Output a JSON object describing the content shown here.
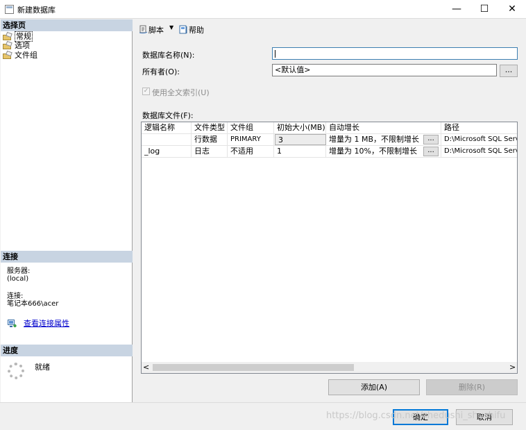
{
  "window": {
    "title": "新建数据库",
    "minimize_glyph": "—",
    "maximize_glyph": "☐",
    "close_glyph": "✕"
  },
  "left_panel": {
    "select_page_header": "选择页",
    "pages": [
      {
        "label": "常规",
        "icon": "page-wrench-icon"
      },
      {
        "label": "选项",
        "icon": "page-wrench-icon"
      },
      {
        "label": "文件组",
        "icon": "page-wrench-icon"
      }
    ],
    "connection_header": "连接",
    "server_label": "服务器:",
    "server_value": "(local)",
    "connection_label": "连接:",
    "connection_value": "笔记本666\\acer",
    "view_connection_link": "查看连接属性",
    "progress_header": "进度",
    "progress_status": "就绪"
  },
  "toolbar": {
    "script_label": "脚本",
    "help_label": "帮助"
  },
  "form": {
    "db_name_label": "数据库名称(N):",
    "db_name_value": "",
    "owner_label": "所有者(O):",
    "owner_value": "<默认值>",
    "owner_browse": "...",
    "fulltext_label": "使用全文索引(U)",
    "db_files_label": "数据库文件(F):"
  },
  "grid": {
    "columns": [
      "逻辑名称",
      "文件类型",
      "文件组",
      "初始大小(MB)",
      "自动增长",
      "路径"
    ],
    "rows": [
      {
        "name": "",
        "type": "行数据",
        "filegroup": "PRIMARY",
        "size": "3",
        "autogrowth": "增量为 1 MB，不限制增长",
        "browse": "...",
        "path": "D:\\Microsoft SQL Serv"
      },
      {
        "name": "_log",
        "type": "日志",
        "filegroup": "不适用",
        "size": "1",
        "autogrowth": "增量为 10%，不限制增长",
        "browse": "...",
        "path": "D:\\Microsoft SQL Serv"
      }
    ],
    "scroll_left": "<",
    "scroll_right": ">"
  },
  "buttons": {
    "add": "添加(A)",
    "remove": "删除(R)",
    "ok": "确定",
    "cancel": "取消"
  },
  "watermark": "https://blog.csdn.net/zhedushi_shushifu"
}
